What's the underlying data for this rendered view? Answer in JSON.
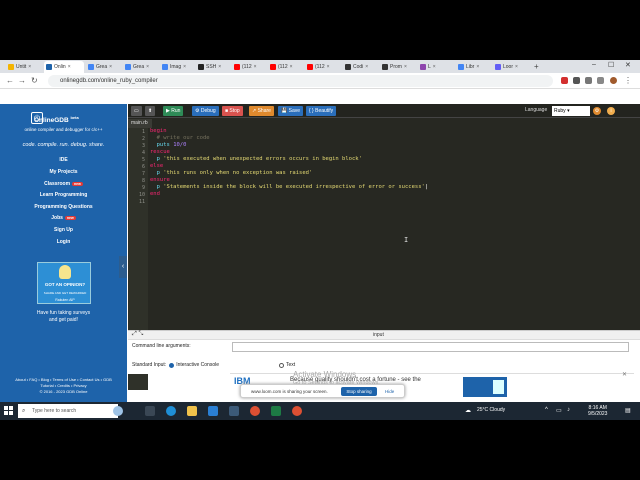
{
  "browser": {
    "tabs": [
      {
        "label": "Untit",
        "color": "#f4b400",
        "active": false
      },
      {
        "label": "Onlin",
        "color": "#1e63aa",
        "active": true
      },
      {
        "label": "Grea",
        "color": "#4285f4",
        "active": false
      },
      {
        "label": "Grea",
        "color": "#4285f4",
        "active": false
      },
      {
        "label": "Imag",
        "color": "#4285f4",
        "active": false
      },
      {
        "label": "SSH",
        "color": "#222222",
        "active": false
      },
      {
        "label": "(112",
        "color": "#ff0000",
        "active": false
      },
      {
        "label": "(112",
        "color": "#ff0000",
        "active": false
      },
      {
        "label": "(112",
        "color": "#ff0000",
        "active": false
      },
      {
        "label": "Codi",
        "color": "#333333",
        "active": false
      },
      {
        "label": "Prom",
        "color": "#333333",
        "active": false
      },
      {
        "label": "L",
        "color": "#8e44ad",
        "active": false
      },
      {
        "label": "Libr",
        "color": "#4285f4",
        "active": false
      },
      {
        "label": "Loor",
        "color": "#625df5",
        "active": false
      }
    ],
    "url": "onlinegdb.com/online_ruby_compiler"
  },
  "sidebar": {
    "brand": "OnlineGDB",
    "brand_sup": "beta",
    "subtitle": "online compiler and debugger for c/c++",
    "motto": "code. compile. run. debug. share.",
    "links": [
      {
        "label": "IDE",
        "badge": ""
      },
      {
        "label": "My Projects",
        "badge": ""
      },
      {
        "label": "Classroom",
        "badge": "new"
      },
      {
        "label": "Learn Programming",
        "badge": ""
      },
      {
        "label": "Programming Questions",
        "badge": ""
      },
      {
        "label": "Jobs",
        "badge": "new"
      },
      {
        "label": "Sign Up",
        "badge": ""
      },
      {
        "label": "Login",
        "badge": ""
      }
    ],
    "ad": {
      "title": "GOT AN OPINION?",
      "subtitle": "SHARE AND GET REWARDED",
      "brand": "Rakuten AIP",
      "caption_line1": "Have fun taking surveys",
      "caption_line2": "and get paid!"
    },
    "footer_line1": "About • FAQ • Blog • Terms of Use • Contact Us • GDB",
    "footer_line2": "Tutorial • Credits • Privacy",
    "footer_line3": "© 2016 - 2023 GDB Online"
  },
  "toolbar": {
    "run": "Run",
    "debug": "Debug",
    "stop": "Stop",
    "share": "Share",
    "save": "Save",
    "beautify": "{ } Beautify",
    "language_label": "Language",
    "language_value": "Ruby"
  },
  "editor": {
    "file_name": "main.rb",
    "lines": [
      "1",
      "2",
      "3",
      "4",
      "5",
      "6",
      "7",
      "8",
      "9",
      "10",
      "11"
    ],
    "code": {
      "l1": "begin",
      "l2": "  # write our code",
      "l3a": "  puts ",
      "l3b": "10/0",
      "l4": "rescue",
      "l5a": "  p ",
      "l5b": "'this executed when unexpected errors occurs in begin block'",
      "l6": "else",
      "l7a": "  p ",
      "l7b": "'this runs only when no exception was raised'",
      "l8": "ensure",
      "l9a": "  p ",
      "l9b": "'Statements inside the block will be executed irrespective of error or success'",
      "l10": "end"
    }
  },
  "input_panel": {
    "header": "input",
    "cmd_label": "Command line arguments:",
    "stdin_label": "Standard Input:",
    "opt_interactive": "Interactive Console",
    "opt_text": "Text"
  },
  "overlay": {
    "ad_logo": "IBM",
    "ad_text": "Because quality shouldn't cost a fortune - see the",
    "watermark_line1": "Activate Windows",
    "watermark_line2": "Go to Settings to activate Windows.",
    "share_msg": "www.loom.com is sharing your screen.",
    "stop_sharing": "Stop sharing",
    "hide": "Hide"
  },
  "taskbar": {
    "search_placeholder": "Type here to search",
    "weather": "25°C  Cloudy",
    "time": "8:16 AM",
    "date": "9/5/2023"
  }
}
